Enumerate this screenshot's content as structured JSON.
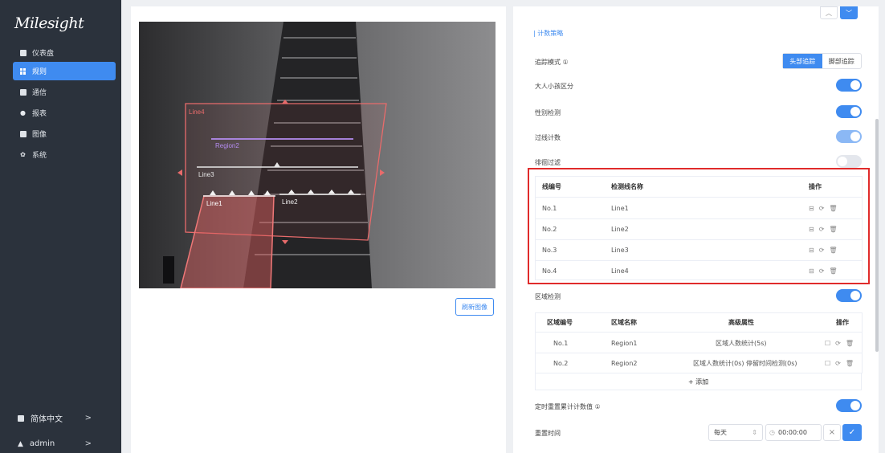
{
  "app": {
    "logo": "Milesight"
  },
  "sidebar": {
    "items": [
      {
        "label": "仪表盘",
        "icon": "dashboard-icon"
      },
      {
        "label": "规则",
        "icon": "rules-icon",
        "active": true
      },
      {
        "label": "通信",
        "icon": "communication-icon"
      },
      {
        "label": "报表",
        "icon": "report-icon"
      },
      {
        "label": "图像",
        "icon": "image-icon"
      },
      {
        "label": "系统",
        "icon": "gear-icon"
      }
    ],
    "language": "简体中文",
    "user": "admin",
    "chevron": ">"
  },
  "video": {
    "lines": [
      "Line1",
      "Line2",
      "Line3",
      "Line4"
    ],
    "regions": [
      "Region1",
      "Region2"
    ],
    "refresh_label": "刷新图像"
  },
  "panel": {
    "section_title": "计数策略",
    "tracking_mode_label": "追踪模式 ①",
    "tracking_options": [
      "头部追踪",
      "脚部追踪"
    ],
    "adult_child_label": "大人小孩区分",
    "gender_label": "性别检测",
    "line_count_label": "过线计数",
    "linger_filter_label": "徘徊过滤",
    "line_table": {
      "headers": [
        "线编号",
        "检测线名称",
        "操作"
      ],
      "rows": [
        {
          "id": "No.1",
          "name": "Line1"
        },
        {
          "id": "No.2",
          "name": "Line2"
        },
        {
          "id": "No.3",
          "name": "Line3"
        },
        {
          "id": "No.4",
          "name": "Line4"
        }
      ]
    },
    "region_detect_label": "区域检测",
    "region_table": {
      "headers": [
        "区域编号",
        "区域名称",
        "高级属性",
        "操作"
      ],
      "rows": [
        {
          "id": "No.1",
          "name": "Region1",
          "attr": "区域人数统计(5s)"
        },
        {
          "id": "No.2",
          "name": "Region2",
          "attr": "区域人数统计(0s) 停留时间检测(0s)"
        }
      ],
      "add_label": "+ 添加"
    },
    "reset_label": "定时重置累计计数值 ①",
    "reset_time_label": "重置时间",
    "reset_frequency": "每天",
    "reset_time": "00:00:00"
  },
  "colors": {
    "accent": "#3f8bf0",
    "highlight": "#e02b2b",
    "sidebar": "#2b323c"
  }
}
